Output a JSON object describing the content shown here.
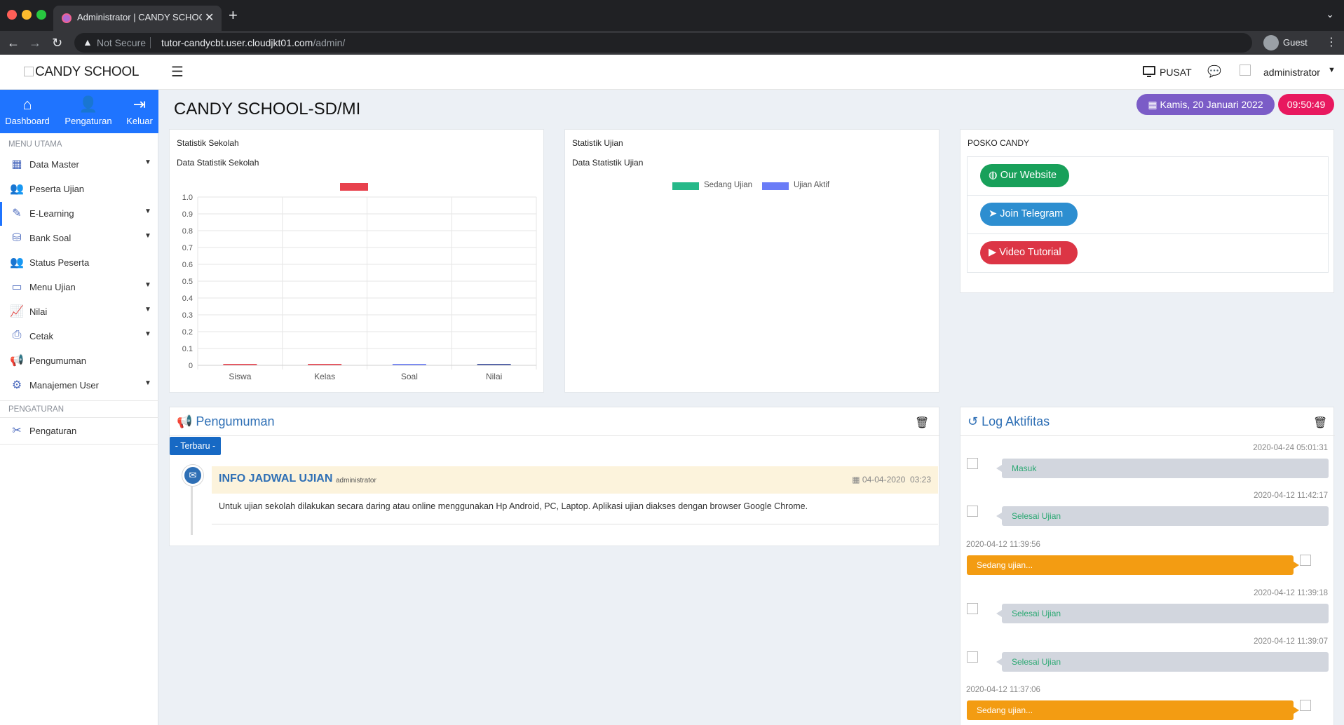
{
  "browser": {
    "tab_title": "Administrator | CANDY SCHOOL",
    "not_secure": "Not Secure",
    "url_host": "tutor-candycbt.user.cloudjkt01.com",
    "url_path": "/admin/",
    "profile": "Guest"
  },
  "header": {
    "logo": "CANDY SCHOOL",
    "pusat": "PUSAT",
    "user": "administrator"
  },
  "sidebar": {
    "quick_nav": [
      {
        "label": "Dashboard"
      },
      {
        "label": "Pengaturan"
      },
      {
        "label": "Keluar"
      }
    ],
    "menu_utama_header": "MENU UTAMA",
    "items": [
      {
        "label": "Data Master"
      },
      {
        "label": "Peserta Ujian"
      },
      {
        "label": "E-Learning"
      },
      {
        "label": "Bank Soal"
      },
      {
        "label": "Status Peserta"
      },
      {
        "label": "Menu Ujian"
      },
      {
        "label": "Nilai"
      },
      {
        "label": "Cetak"
      },
      {
        "label": "Pengumuman"
      },
      {
        "label": "Manajemen User"
      }
    ],
    "pengaturan_header": "PENGATURAN",
    "pengaturan_item": "Pengaturan"
  },
  "main": {
    "page_title": "CANDY SCHOOL-SD/MI",
    "date": "Kamis, 20 Januari 2022",
    "time": "09:50:49"
  },
  "stat_sekolah": {
    "title": "Statistik Sekolah",
    "subtitle": "Data Statistik Sekolah"
  },
  "stat_ujian": {
    "title": "Statistik Ujian",
    "subtitle": "Data Statistik Ujian",
    "legend": [
      "Sedang Ujian",
      "Ujian Aktif"
    ],
    "legend_colors": [
      "#26b989",
      "#6a7cf7"
    ]
  },
  "chart_data": {
    "type": "bar",
    "categories": [
      "Siswa",
      "Kelas",
      "Soal",
      "Nilai"
    ],
    "values": [
      0,
      0,
      0,
      0
    ],
    "bar_colors": [
      "#e8414d",
      "#e8414d",
      "#6a7cf7",
      "#3f4fa0"
    ],
    "legend_color": "#e8414d",
    "title": "",
    "xlabel": "",
    "ylabel": "",
    "ylim": [
      0,
      1.0
    ],
    "y_ticks": [
      "0",
      "0.1",
      "0.2",
      "0.3",
      "0.4",
      "0.5",
      "0.6",
      "0.7",
      "0.8",
      "0.9",
      "1.0"
    ],
    "grid": true
  },
  "posko": {
    "title": "POSKO CANDY",
    "buttons": [
      {
        "label": "Our Website"
      },
      {
        "label": "Join Telegram"
      },
      {
        "label": "Video Tutorial"
      }
    ]
  },
  "pengumuman": {
    "title": "Pengumuman",
    "badge": "- Terbaru -",
    "item": {
      "title": "INFO JADWAL UJIAN",
      "author": "administrator",
      "date": "04-04-2020",
      "time": "03:23",
      "body": "Untuk ujian sekolah dilakukan secara daring atau online menggunakan Hp Android, PC, Laptop. Aplikasi ujian diakses dengan browser Google Chrome."
    }
  },
  "log": {
    "title": "Log Aktifitas",
    "entries": [
      {
        "time": "2020-04-24 05:01:31",
        "text": "Masuk"
      },
      {
        "time": "2020-04-12 11:42:17",
        "text": "Selesai Ujian"
      },
      {
        "time": "2020-04-12 11:39:56",
        "text": "Sedang ujian..."
      },
      {
        "time": "2020-04-12 11:39:18",
        "text": "Selesai Ujian"
      },
      {
        "time": "2020-04-12 11:39:07",
        "text": "Selesai Ujian"
      },
      {
        "time": "2020-04-12 11:37:06",
        "text": "Sedang ujian..."
      }
    ]
  }
}
